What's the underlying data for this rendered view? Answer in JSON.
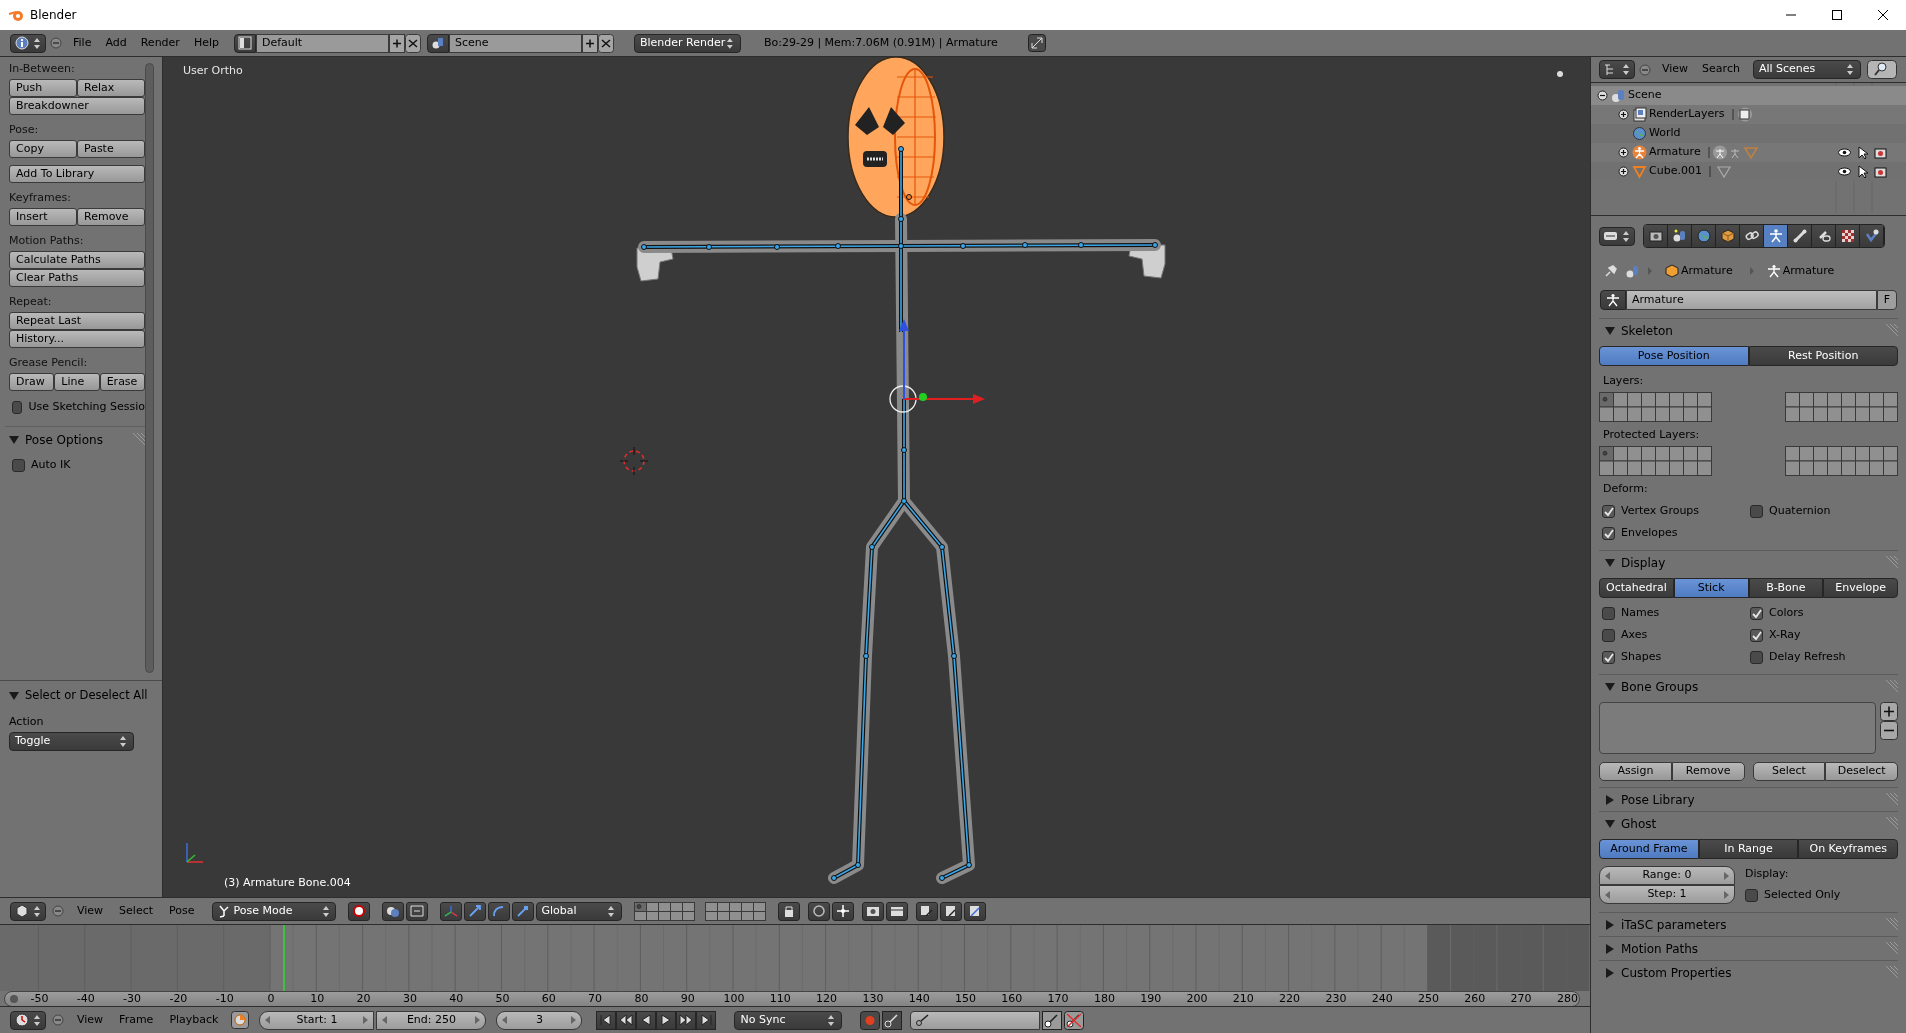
{
  "window": {
    "title": "Blender"
  },
  "info_header": {
    "menus": [
      "File",
      "Add",
      "Render",
      "Help"
    ],
    "screen_layout": "Default",
    "scene": "Scene",
    "render_engine": "Blender Render",
    "stats": "Bo:29-29 | Mem:7.06M (0.91M) | Armature"
  },
  "tool_shelf": {
    "groups": [
      {
        "label": "In-Between:",
        "blocks": [
          [
            [
              "Push",
              "Relax"
            ],
            [
              "Breakdowner"
            ]
          ]
        ]
      },
      {
        "label": "Pose:",
        "blocks": [
          [
            [
              "Copy",
              "Paste"
            ]
          ],
          [
            [
              "Add To Library"
            ]
          ]
        ]
      },
      {
        "label": "Keyframes:",
        "blocks": [
          [
            [
              "Insert",
              "Remove"
            ]
          ]
        ]
      },
      {
        "label": "Motion Paths:",
        "blocks": [
          [
            [
              "Calculate Paths"
            ],
            [
              "Clear Paths"
            ]
          ]
        ]
      },
      {
        "label": "Repeat:",
        "blocks": [
          [
            [
              "Repeat Last"
            ],
            [
              "History..."
            ]
          ]
        ]
      },
      {
        "label": "Grease Pencil:",
        "blocks": [
          [
            [
              "Draw",
              "Line",
              "Erase"
            ]
          ]
        ],
        "checkbox": {
          "label": "Use Sketching Sessio",
          "checked": false
        }
      }
    ],
    "panels": [
      {
        "title": "Pose Options",
        "expanded": true,
        "checkboxes": [
          {
            "label": "Auto IK",
            "checked": false
          }
        ]
      }
    ]
  },
  "operator_panel": {
    "title": "Select or Deselect All",
    "expanded": true,
    "field_label": "Action",
    "dropdown": "Toggle"
  },
  "viewport": {
    "view_name": "User Ortho",
    "object_info": "(3) Armature Bone.004"
  },
  "viewport_header": {
    "menus": [
      "View",
      "Select",
      "Pose"
    ],
    "mode": "Pose Mode",
    "orientation": "Global"
  },
  "timeline": {
    "ruler": [
      "-50",
      "-40",
      "-30",
      "-20",
      "-10",
      "0",
      "10",
      "20",
      "30",
      "40",
      "50",
      "60",
      "70",
      "80",
      "90",
      "100",
      "110",
      "120",
      "130",
      "140",
      "150",
      "160",
      "170",
      "180",
      "190",
      "200",
      "210",
      "220",
      "230",
      "240",
      "250",
      "260",
      "270",
      "280"
    ]
  },
  "timeline_header": {
    "menus": [
      "View",
      "Frame",
      "Playback"
    ],
    "start": "Start: 1",
    "end": "End: 250",
    "current_frame": "3",
    "sync": "No Sync"
  },
  "outliner": {
    "menus": [
      "View",
      "Search"
    ],
    "display": "All Scenes",
    "tree": [
      {
        "label": "Scene",
        "kind": "scene",
        "expanded": true,
        "selected": true,
        "children": [
          {
            "label": "RenderLayers",
            "kind": "renderlayers",
            "expanded": false,
            "selected": false
          },
          {
            "label": "World",
            "kind": "world",
            "selected": false
          },
          {
            "label": "Armature",
            "kind": "armature",
            "expanded": false,
            "selected": false
          },
          {
            "label": "Cube.001",
            "kind": "mesh",
            "expanded": false,
            "selected": false
          }
        ]
      }
    ]
  },
  "properties": {
    "tabs": [
      {
        "kind": "render",
        "selected": false
      },
      {
        "kind": "scene",
        "selected": false
      },
      {
        "kind": "world",
        "selected": false
      },
      {
        "kind": "object",
        "selected": false
      },
      {
        "kind": "constraints",
        "selected": false
      },
      {
        "kind": "armature",
        "selected": true
      },
      {
        "kind": "bone",
        "selected": false
      },
      {
        "kind": "bone-constraints",
        "selected": false
      },
      {
        "kind": "texture",
        "selected": false
      },
      {
        "kind": "physics",
        "selected": false
      }
    ],
    "breadcrumb": [
      "Armature",
      "Armature"
    ],
    "datablock": {
      "name": "Armature",
      "fake_user": "F"
    },
    "panels": [
      {
        "title": "Skeleton",
        "expanded": true,
        "items": [
          {
            "kind": "segmented",
            "options": [
              {
                "label": "Pose Position",
                "selected": true
              },
              {
                "label": "Rest Position",
                "selected": false
              }
            ]
          },
          {
            "kind": "label",
            "text": "Layers:"
          },
          {
            "kind": "layers"
          },
          {
            "kind": "label",
            "text": "Protected Layers:"
          },
          {
            "kind": "layers"
          },
          {
            "kind": "label",
            "text": "Deform:"
          },
          {
            "kind": "checks",
            "checks": [
              {
                "label": "Vertex Groups",
                "checked": true
              },
              {
                "label": "Quaternion",
                "checked": false
              },
              {
                "label": "Envelopes",
                "checked": true
              }
            ]
          }
        ]
      },
      {
        "title": "Display",
        "expanded": true,
        "items": [
          {
            "kind": "segmented",
            "options": [
              {
                "label": "Octahedral",
                "selected": false
              },
              {
                "label": "Stick",
                "selected": true
              },
              {
                "label": "B-Bone",
                "selected": false
              },
              {
                "label": "Envelope",
                "selected": false
              }
            ]
          },
          {
            "kind": "checks",
            "checks": [
              {
                "label": "Names",
                "checked": false
              },
              {
                "label": "Colors",
                "checked": true
              },
              {
                "label": "Axes",
                "checked": false
              },
              {
                "label": "X-Ray",
                "checked": true
              },
              {
                "label": "Shapes",
                "checked": true
              },
              {
                "label": "Delay Refresh",
                "checked": false
              }
            ]
          }
        ]
      },
      {
        "title": "Bone Groups",
        "expanded": true,
        "items": [
          {
            "kind": "list"
          },
          {
            "kind": "buttons",
            "groups": [
              [
                "Assign",
                "Remove"
              ],
              [
                "Select",
                "Deselect"
              ]
            ]
          }
        ]
      },
      {
        "title": "Pose Library",
        "expanded": false
      },
      {
        "title": "Ghost",
        "expanded": true,
        "items": [
          {
            "kind": "segmented",
            "options": [
              {
                "label": "Around Frame",
                "selected": true
              },
              {
                "label": "In Range",
                "selected": false
              },
              {
                "label": "On Keyframes",
                "selected": false
              }
            ]
          },
          {
            "kind": "ghost",
            "fields": [
              "Range: 0",
              "Step: 1"
            ],
            "label": "Display:",
            "check": {
              "label": "Selected Only",
              "checked": false
            }
          }
        ]
      },
      {
        "title": "iTaSC parameters",
        "expanded": false
      },
      {
        "title": "Motion Paths",
        "expanded": false
      },
      {
        "title": "Custom Properties",
        "expanded": false
      }
    ]
  }
}
